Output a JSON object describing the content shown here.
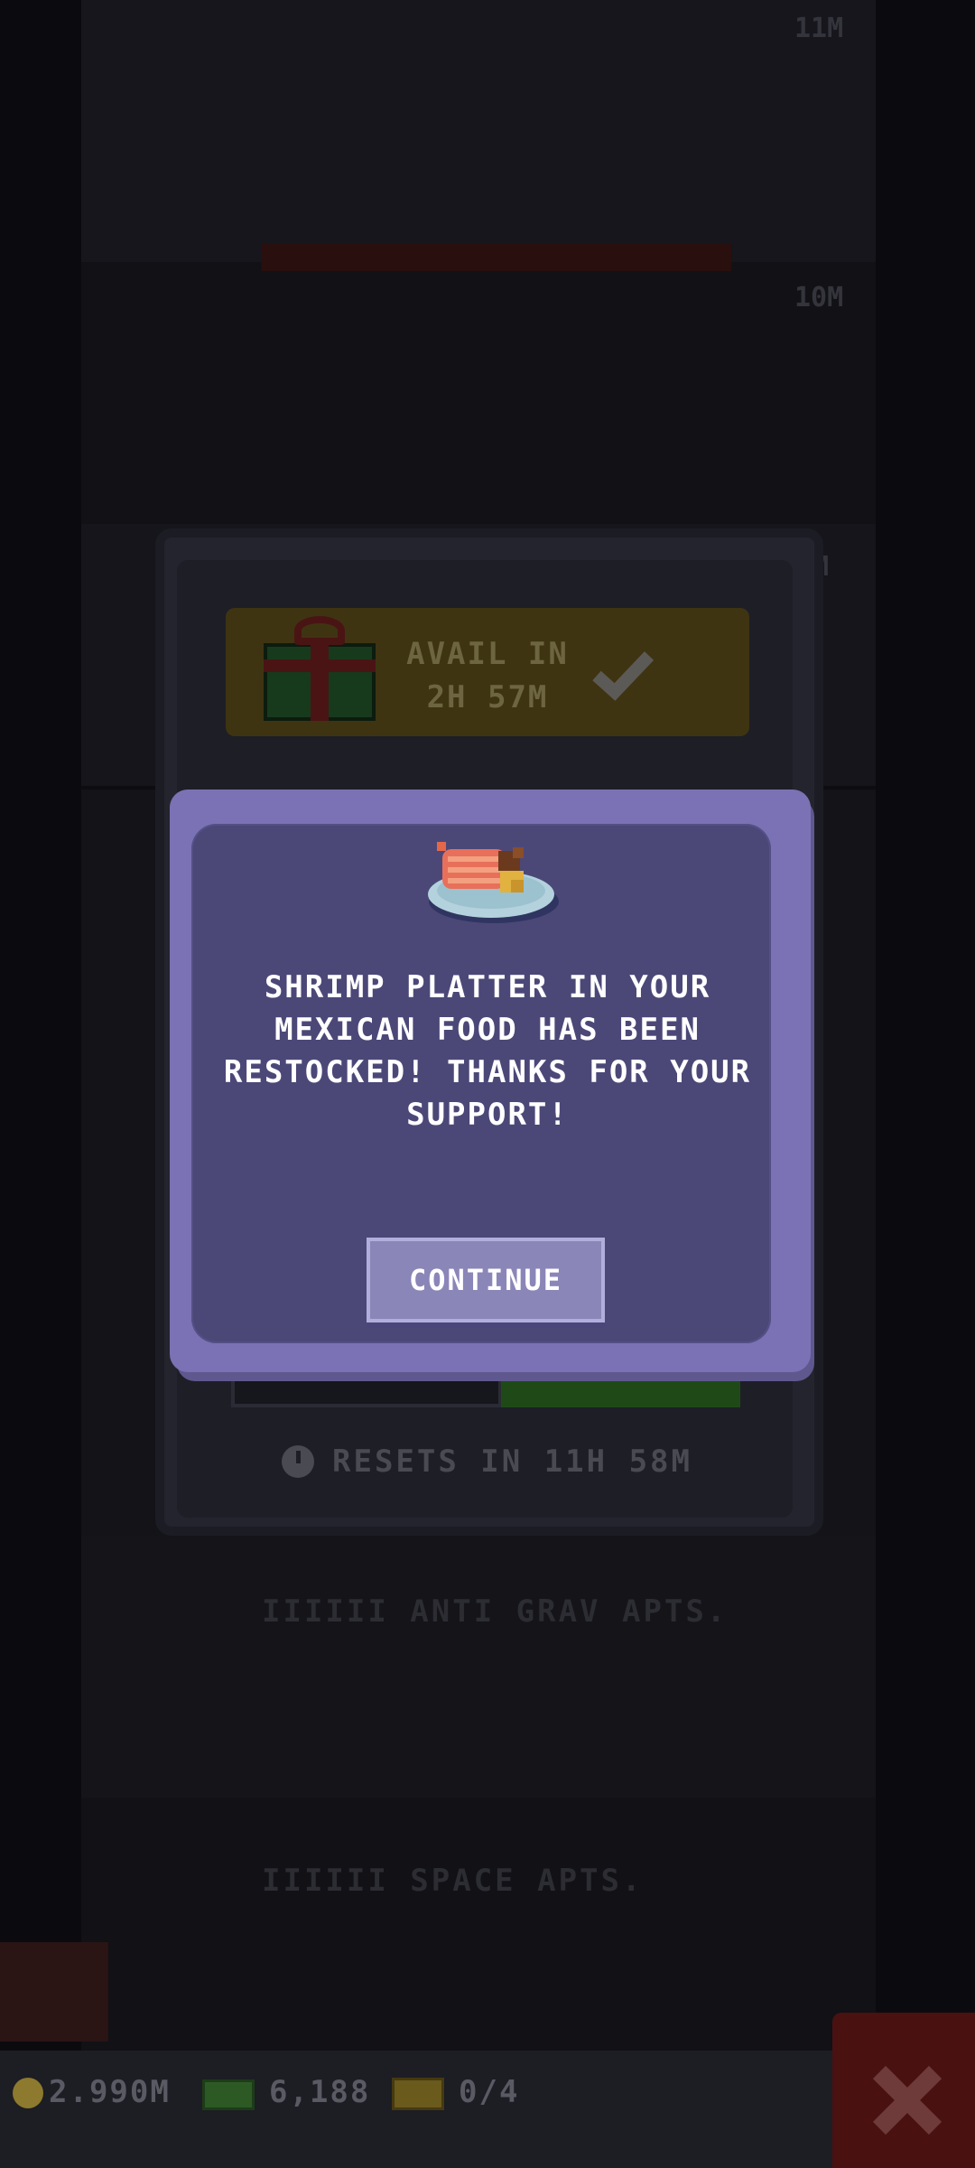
{
  "background": {
    "floor_labels": [
      "11M",
      "10M",
      "M"
    ],
    "tower_rows": [
      "IIIIII ANTI GRAV APTS.",
      "IIIIII SPACE APTS."
    ]
  },
  "gift_panel": {
    "availability_line1": "AVAIL IN",
    "availability_line2": "2H 57M",
    "reset_text": "RESETS IN 11H 58M"
  },
  "modal": {
    "message": "SHRIMP PLATTER IN YOUR MEXICAN FOOD HAS BEEN RESTOCKED! THANKS FOR YOUR SUPPORT!",
    "food_icon": "shrimp-platter-icon",
    "continue_label": "CONTINUE"
  },
  "hud": {
    "coins": "2.990M",
    "bux": "6,188",
    "tickets": "0/4"
  },
  "colors": {
    "modal_frame": "#7a72b4",
    "modal_body": "#4b4878",
    "button": "#8b86b8",
    "close": "#4a1111"
  }
}
